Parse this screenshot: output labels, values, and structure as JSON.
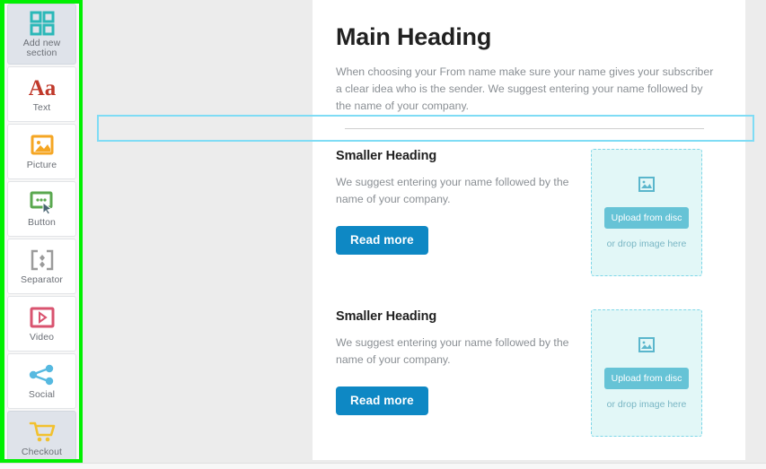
{
  "sidebar": {
    "items": [
      {
        "label": "Add new\nsection",
        "icon": "grid-icon",
        "active": true,
        "color": "#2bb8b8"
      },
      {
        "label": "Text",
        "icon": "text-aa-icon",
        "active": false,
        "color": "#c0392b"
      },
      {
        "label": "Picture",
        "icon": "picture-icon",
        "active": false,
        "color": "#f5a623"
      },
      {
        "label": "Button",
        "icon": "button-icon",
        "active": false,
        "color": "#5aa84f"
      },
      {
        "label": "Separator",
        "icon": "separator-icon",
        "active": false,
        "color": "#9b9b9b"
      },
      {
        "label": "Video",
        "icon": "video-play-icon",
        "active": false,
        "color": "#d9536f"
      },
      {
        "label": "Social",
        "icon": "social-share-icon",
        "active": false,
        "color": "#56b9e0"
      },
      {
        "label": "Checkout",
        "icon": "cart-icon",
        "active": true,
        "color": "#f2c12e"
      }
    ],
    "highlight_color": "#00f000"
  },
  "canvas": {
    "main_heading": "Main Heading",
    "main_paragraph": "When choosing your From name make sure your name gives your subscriber a clear idea who is the sender. We suggest entering your name followed by the name of your company.",
    "separator": {
      "name": "separator-block",
      "highlight_color": "#7fdcf5"
    },
    "rows": [
      {
        "heading": "Smaller Heading",
        "paragraph": "We suggest entering your name followed by the name of your company.",
        "button_label": "Read more",
        "dropzone": {
          "button_label": "Upload from disc",
          "hint": "or drop image here",
          "icon": "image-placeholder-icon"
        }
      },
      {
        "heading": "Smaller Heading",
        "paragraph": "We suggest entering your name followed by the name of your company.",
        "button_label": "Read more",
        "dropzone": {
          "button_label": "Upload from disc",
          "hint": "or drop image here",
          "icon": "image-placeholder-icon"
        }
      }
    ],
    "colors": {
      "read_more_bg": "#0e88c4",
      "dropzone_bg": "#e2f7f7",
      "dropzone_border": "#7fd7e8",
      "upload_button_bg": "#66c3d6"
    }
  }
}
